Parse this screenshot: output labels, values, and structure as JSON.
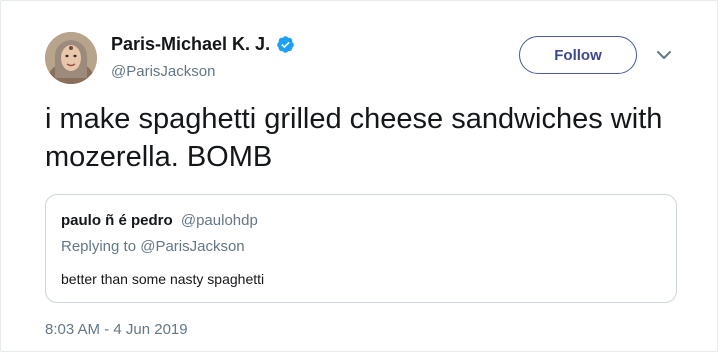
{
  "author": {
    "display_name": "Paris-Michael K. J.",
    "handle": "@ParisJackson",
    "verified": true,
    "avatar_icon": "profile-photo"
  },
  "follow_button": {
    "label": "Follow"
  },
  "menu": {
    "icon": "chevron-down-icon"
  },
  "tweet": {
    "text": "i make spaghetti grilled cheese sandwiches with mozerella. BOMB",
    "timestamp": "8:03 AM - 4 Jun 2019"
  },
  "quoted_tweet": {
    "display_name": "paulo ñ é pedro",
    "handle": "@paulohdp",
    "replying_prefix": "Replying to",
    "replying_to": "@ParisJackson",
    "text": "better than some nasty spaghetti"
  },
  "colors": {
    "text_primary": "#14171a",
    "text_secondary": "#657786",
    "verified_blue": "#1da1f2",
    "follow_border": "#4a5a9d",
    "border": "#ccd6dd"
  }
}
